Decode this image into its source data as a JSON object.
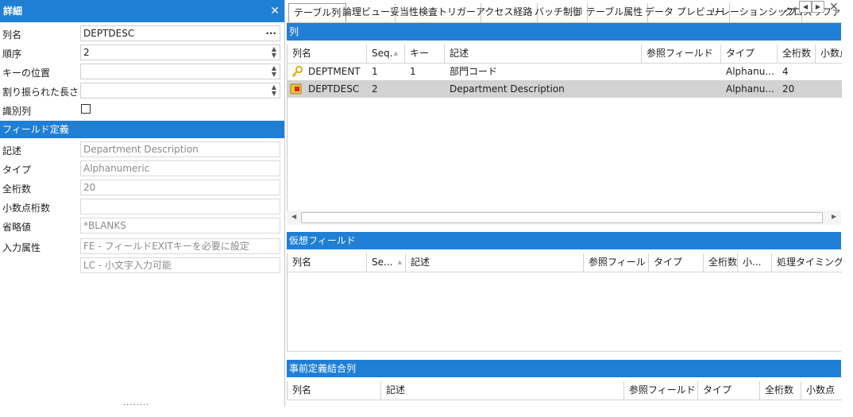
{
  "detail_panel": {
    "title": "詳細",
    "close_glyph": "✕",
    "rows": [
      {
        "label": "列名",
        "value": "DEPTDESC",
        "control": "dots"
      },
      {
        "label": "順序",
        "value": "2",
        "control": "spin"
      },
      {
        "label": "キーの位置",
        "value": "",
        "control": "spin"
      },
      {
        "label": "割り振られた長さ",
        "value": "",
        "control": "spin"
      },
      {
        "label": "識別列",
        "value": "",
        "control": "checkbox",
        "checked": false
      }
    ],
    "field_section": {
      "title": "フィールド定義",
      "rows": [
        {
          "label": "記述",
          "value": "Department Description"
        },
        {
          "label": "タイプ",
          "value": "Alphanumeric"
        },
        {
          "label": "全桁数",
          "value": "20"
        },
        {
          "label": "小数点桁数",
          "value": ""
        },
        {
          "label": "省略値",
          "value": "*BLANKS"
        },
        {
          "label": "入力属性",
          "value": "FE - フィールドEXITキーを必要に設定"
        },
        {
          "label": "",
          "value": "LC - 小文字入力可能"
        }
      ]
    },
    "grip": "........"
  },
  "tabs": [
    {
      "label": "テーブル列",
      "active": true
    },
    {
      "label": "論理ビュー",
      "active": false
    },
    {
      "label": "妥当性検査トリガー",
      "active": false
    },
    {
      "label": "アクセス経路",
      "active": false
    },
    {
      "label": "バッチ制御",
      "active": false
    },
    {
      "label": "テーブル属性",
      "active": false
    },
    {
      "label": "データ プレビュー",
      "active": false
    },
    {
      "label": "リレーションシップ",
      "active": false
    },
    {
      "label": "クロスリファレンス",
      "active": false
    }
  ],
  "tab_nav": {
    "prev": "◀",
    "next": "▶",
    "close": "✕"
  },
  "columns_section": {
    "title": "列",
    "headers": [
      "列名",
      "Seq.",
      "キー",
      "記述",
      "参照フィールド",
      "タイプ",
      "全桁数",
      "小数点"
    ],
    "rows": [
      {
        "icon": "key-icon",
        "name": "DEPTMENT",
        "seq": "1",
        "key": "1",
        "desc": "部門コード",
        "ref": "",
        "type": "Alphanu...",
        "length": "4",
        "decimals": "",
        "selected": false
      },
      {
        "icon": "column-icon",
        "name": "DEPTDESC",
        "seq": "2",
        "key": "",
        "desc": "Department Description",
        "ref": "",
        "type": "Alphanu...",
        "length": "20",
        "decimals": "",
        "selected": true
      }
    ]
  },
  "virtual_section": {
    "title": "仮想フィールド",
    "headers": [
      "列名",
      "Se...",
      "記述",
      "参照フィールド",
      "タイプ",
      "全桁数",
      "小...",
      "処理タイミング"
    ]
  },
  "join_section": {
    "title": "事前定義結合列",
    "headers": [
      "列名",
      "記述",
      "参照フィールド",
      "タイプ",
      "全桁数",
      "小数点"
    ]
  },
  "scrollbar": {
    "left": "◀",
    "right": "▶"
  },
  "colors": {
    "accent": "#1f7fd5",
    "selected_row": "#d2d2d2"
  }
}
